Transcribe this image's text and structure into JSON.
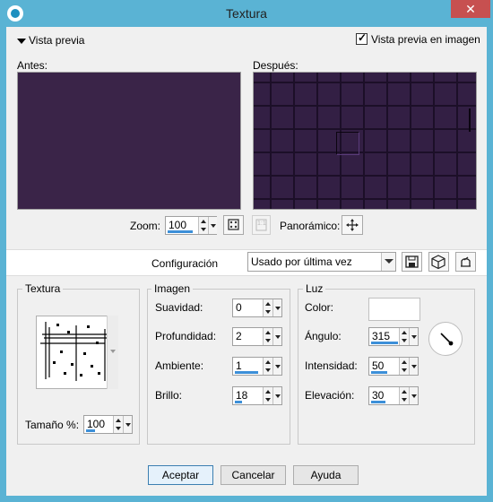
{
  "window": {
    "title": "Textura",
    "close": "✕"
  },
  "preview_toggle": {
    "label": "Vista previa"
  },
  "preview_in_image": {
    "label": "Vista previa en imagen",
    "checked": true
  },
  "before": {
    "label": "Antes:"
  },
  "after": {
    "label": "Después:"
  },
  "zoom": {
    "label": "Zoom:",
    "value": "100"
  },
  "zoom_actual_icon": "1:1",
  "panoramic": {
    "label": "Panorámico:"
  },
  "configuration": {
    "label": "Configuración",
    "value": "Usado por última vez"
  },
  "texture_group": {
    "title": "Textura",
    "size_label": "Tamaño %:",
    "size_value": "100"
  },
  "image_group": {
    "title": "Imagen",
    "fields": [
      {
        "label": "Suavidad:",
        "value": "0"
      },
      {
        "label": "Profundidad:",
        "value": "2"
      },
      {
        "label": "Ambiente:",
        "value": "1"
      },
      {
        "label": "Brillo:",
        "value": "18"
      }
    ]
  },
  "light_group": {
    "title": "Luz",
    "color_label": "Color:",
    "color_value": "#ffffff",
    "fields": [
      {
        "label": "Ángulo:",
        "value": "315"
      },
      {
        "label": "Intensidad:",
        "value": "50"
      },
      {
        "label": "Elevación:",
        "value": "30"
      }
    ]
  },
  "buttons": {
    "ok": "Aceptar",
    "cancel": "Cancelar",
    "help": "Ayuda"
  },
  "colors": {
    "titlebar": "#5ab3d4",
    "close": "#c75050",
    "preview_before": "#3a2448",
    "preview_after": "#331f44",
    "accent": "#3c8fd8"
  }
}
